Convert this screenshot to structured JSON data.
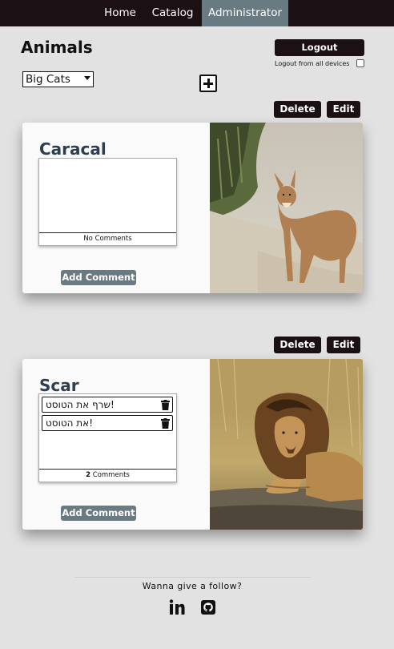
{
  "nav": {
    "home": "Home",
    "catalog": "Catalog",
    "administrator": "Administrator"
  },
  "page_title": "Animals",
  "logout": {
    "label": "Logout",
    "all_devices_label": "Logout from all devices",
    "all_devices_checked": false
  },
  "category_select": {
    "selected": "Big Cats"
  },
  "cards": [
    {
      "name": "Caracal",
      "delete_label": "Delete",
      "edit_label": "Edit",
      "comments": [],
      "comments_footer_text": "No Comments",
      "add_comment_label": "Add Comment",
      "image": "caracal-photo"
    },
    {
      "name": "Scar",
      "delete_label": "Delete",
      "edit_label": "Edit",
      "comments": [
        "שרף את הטוסט!",
        "את הטוסט!"
      ],
      "comments_count": "2",
      "comments_count_label": "Comments",
      "add_comment_label": "Add Comment",
      "image": "lion-photo"
    }
  ],
  "footer": {
    "text": "Wanna give a follow?",
    "icons": [
      "linkedin-icon",
      "github-icon"
    ]
  }
}
